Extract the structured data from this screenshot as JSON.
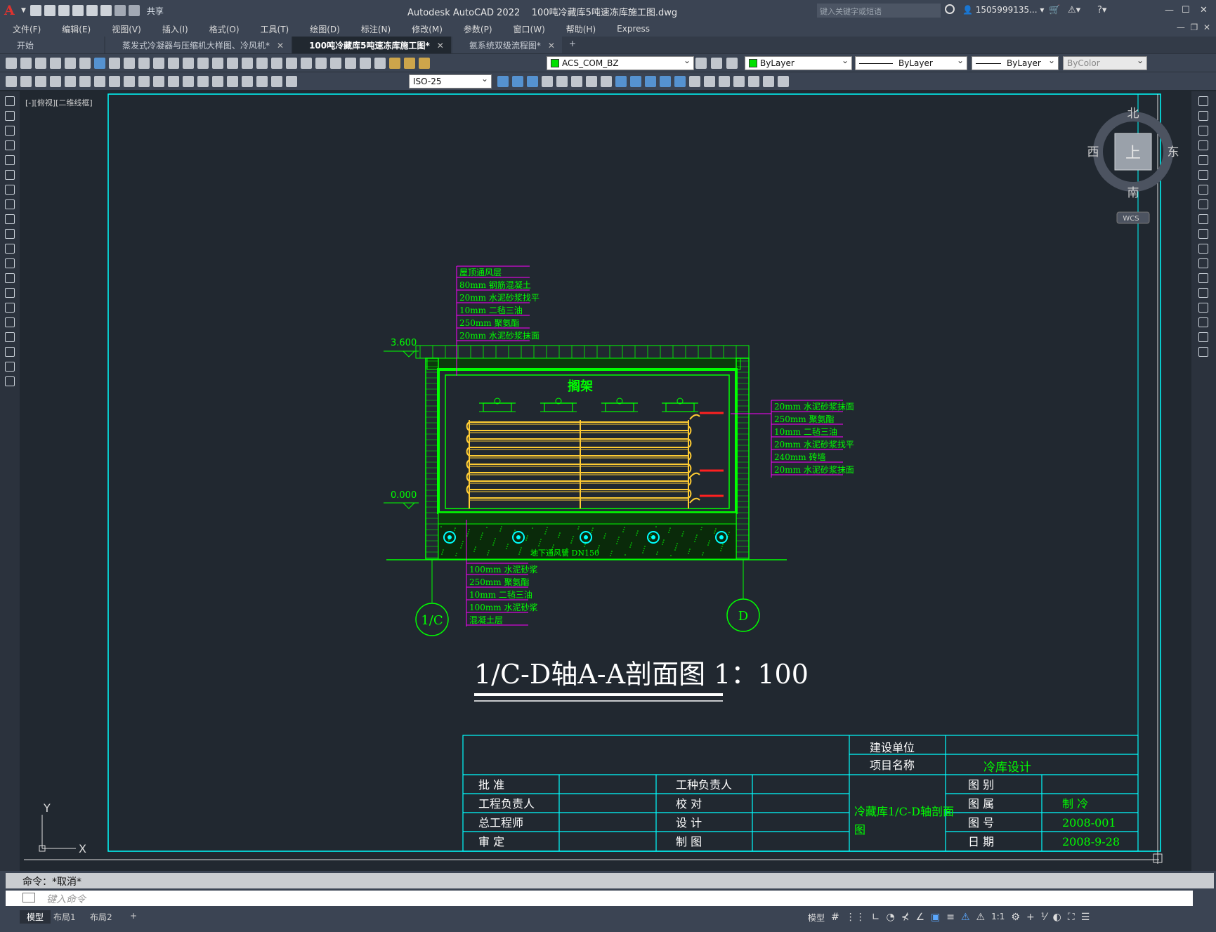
{
  "app": {
    "title": "Autodesk AutoCAD 2022",
    "file": "100吨冷藏库5吨速冻库施工图.dwg",
    "share": "共享",
    "search_placeholder": "键入关键字或短语",
    "user": "1505999135..."
  },
  "menu": [
    "文件(F)",
    "编辑(E)",
    "视图(V)",
    "插入(I)",
    "格式(O)",
    "工具(T)",
    "绘图(D)",
    "标注(N)",
    "修改(M)",
    "参数(P)",
    "窗口(W)",
    "帮助(H)",
    "Express"
  ],
  "tabs": [
    {
      "label": "开始"
    },
    {
      "label": "蒸发式冷凝器与压缩机大样图、冷风机*"
    },
    {
      "label": "100吨冷藏库5吨速冻库施工图*",
      "active": true
    },
    {
      "label": "氨系统双级流程图*"
    }
  ],
  "props": {
    "layer": "ACS_COM_BZ",
    "color": "ByLayer",
    "linetype": "ByLayer",
    "lineweight": "ByLayer",
    "plotstyle": "ByColor",
    "dimstyle": "ISO-25"
  },
  "viewport": {
    "label": "[-][俯视][二维线框]"
  },
  "viewcube": {
    "top": "上",
    "north": "北",
    "south": "南",
    "east": "东",
    "west": "西",
    "wcs": "WCS"
  },
  "drawing": {
    "roof_notes": [
      "屋顶通风层",
      "80mm  钢筋混凝土",
      "20mm  水泥砂浆找平",
      "10mm  二毡三油",
      "250mm  聚氨酯",
      "20mm  水泥砂浆抹面"
    ],
    "wall_notes": [
      "20mm  水泥砂浆抹面",
      "250mm  聚氨酯",
      "10mm  二毡三油",
      "20mm  水泥砂浆找平",
      "240mm  砖墙",
      "20mm  水泥砂浆抹面"
    ],
    "floor_notes": [
      "100mm  水泥砂浆",
      "250mm  聚氨酯",
      "10mm  二毡三油",
      "100mm  水泥砂浆",
      "混凝土层"
    ],
    "elev_top": "3.600",
    "elev_bottom": "0.000",
    "rack": "搁架",
    "duct": "地下通风管 DN150",
    "axis_left": "1/C",
    "axis_right": "D",
    "title": "1/C-D轴A-A剖面图 1：100"
  },
  "titleblock": {
    "build_unit": "建设单位",
    "project_name": "项目名称",
    "project_value": "冷库设计",
    "approve": "批    准",
    "eng_lead": "工程负责人",
    "chief": "总工程师",
    "review": "审    定",
    "trade_lead": "工种负责人",
    "check": "校    对",
    "design": "设    计",
    "draw": "制    图",
    "drawing_name": "冷藏库1/C-D轴剖面图",
    "cat_k": "图    别",
    "belong_k": "图    属",
    "num_k": "图    号",
    "date_k": "日    期",
    "belong_v": "制    冷",
    "num_v": "2008-001",
    "date_v": "2008-9-28"
  },
  "command": {
    "history": "命令：*取消*",
    "placeholder": "键入命令"
  },
  "layout_tabs": [
    "模型",
    "布局1",
    "布局2"
  ],
  "status": {
    "model": "模型",
    "scale": "1:1"
  },
  "colors": {
    "green": "#00ff00",
    "magenta": "#ff00ff",
    "yellow": "#ffcc33",
    "red": "#ff2020",
    "cyan": "#00ffff"
  }
}
